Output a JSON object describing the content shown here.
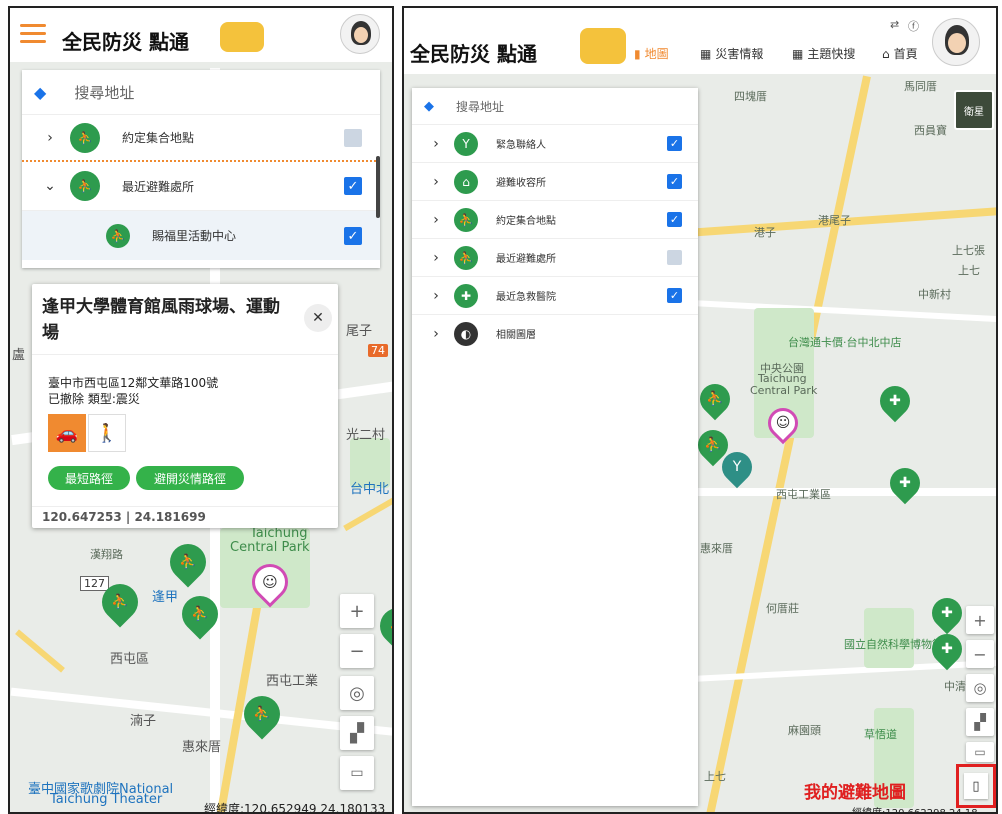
{
  "left_panel": {
    "logo_text": "全民防災  點通",
    "search_label": "搜尋地址",
    "layers": [
      {
        "label": "約定集合地點",
        "checked": false,
        "expanded": false
      },
      {
        "label": "最近避難處所",
        "checked": true,
        "expanded": true
      }
    ],
    "sublayer": {
      "label": "賜福里活動中心",
      "checked": true
    },
    "card": {
      "title": "逢甲大學體育館風雨球場、運動場",
      "address": "臺中市西屯區12鄰文華路100號",
      "status": "已撤除 類型:震災",
      "btn_shortest": "最短路徑",
      "btn_avoid": "避開災情路徑",
      "coords": "120.647253 | 24.181699",
      "close": "✕"
    },
    "footer_coords": "經緯度:120.652949 24.180133",
    "map_labels": [
      "Taichung",
      "Central Park",
      "逢甲",
      "西屯區",
      "西屯工業",
      "湳子",
      "惠來厝",
      "臺中國家歌劇院National",
      "Taichung Theater",
      "光二村",
      "台中北",
      "漢翔路",
      "尾子",
      "盧",
      "74",
      "127"
    ]
  },
  "right_panel": {
    "logo_text": "全民防災  點通",
    "nav": [
      {
        "label": "地圖",
        "active": true
      },
      {
        "label": "災害情報",
        "active": false
      },
      {
        "label": "主題快搜",
        "active": false
      },
      {
        "label": "首頁",
        "active": false
      }
    ],
    "search_label": "搜尋地址",
    "layers": [
      {
        "label": "緊急聯絡人",
        "checked": true
      },
      {
        "label": "避難收容所",
        "checked": true
      },
      {
        "label": "約定集合地點",
        "checked": true
      },
      {
        "label": "最近避難處所",
        "checked": false
      },
      {
        "label": "最近急救醫院",
        "checked": true
      },
      {
        "label": "相關圖層",
        "checked": null
      }
    ],
    "map_labels": [
      "馬同厝",
      "西員寶",
      "四塊厝",
      "港子",
      "港尾子",
      "上七張",
      "上七",
      "中新村",
      "台灣通卡價·台中北中店",
      "中央公園",
      "Taichung",
      "Central Park",
      "西屯工業區",
      "惠來厝",
      "何厝莊",
      "國立自然科學博物館",
      "麻園頭",
      "草悟道",
      "中清",
      "上七"
    ],
    "satellite_label": "衛星",
    "footer_coords": "經緯度:120.662298 24.18",
    "my_map_label": "我的避難地圖"
  },
  "colors": {
    "accent_orange": "#f08a30",
    "primary_green": "#2e9b4e",
    "checkbox_blue": "#1a73e8",
    "highlight_red": "#e02020"
  }
}
